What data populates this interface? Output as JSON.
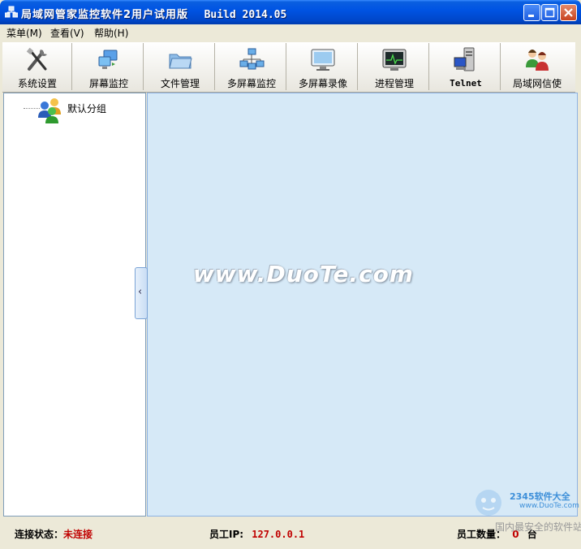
{
  "window": {
    "title": "局域网管家监控软件2用户试用版",
    "build": "Build 2014.05"
  },
  "menu": {
    "items": [
      {
        "label": "菜单(M)"
      },
      {
        "label": "查看(V)"
      },
      {
        "label": "帮助(H)"
      }
    ]
  },
  "toolbar": {
    "buttons": [
      {
        "label": "系统设置",
        "icon": "tools-icon"
      },
      {
        "label": "屏幕监控",
        "icon": "screen-monitor-icon"
      },
      {
        "label": "文件管理",
        "icon": "folder-icon"
      },
      {
        "label": "多屏幕监控",
        "icon": "network-monitor-icon"
      },
      {
        "label": "多屏幕录像",
        "icon": "display-icon"
      },
      {
        "label": "进程管理",
        "icon": "process-monitor-icon"
      },
      {
        "label": "Telnet",
        "icon": "terminal-computer-icon"
      },
      {
        "label": "局域网信使",
        "icon": "users-chat-icon"
      }
    ]
  },
  "tree": {
    "root_label": "默认分组"
  },
  "content": {
    "watermark": "www.DuoTe.com"
  },
  "status": {
    "connection_label": "连接状态：",
    "connection_value": "未连接",
    "ip_label": "员工IP:",
    "ip_value": "127.0.0.1",
    "count_label": "员工数量：",
    "count_value": "0",
    "count_unit": "台"
  },
  "corner_watermark": {
    "brand": "2345软件大全",
    "url": "www.DuoTe.com",
    "slogan": "国内最安全的软件站"
  },
  "colors": {
    "titlebar": "#0054E3",
    "content_bg": "#D6E9F7",
    "status_red": "#C00000"
  }
}
